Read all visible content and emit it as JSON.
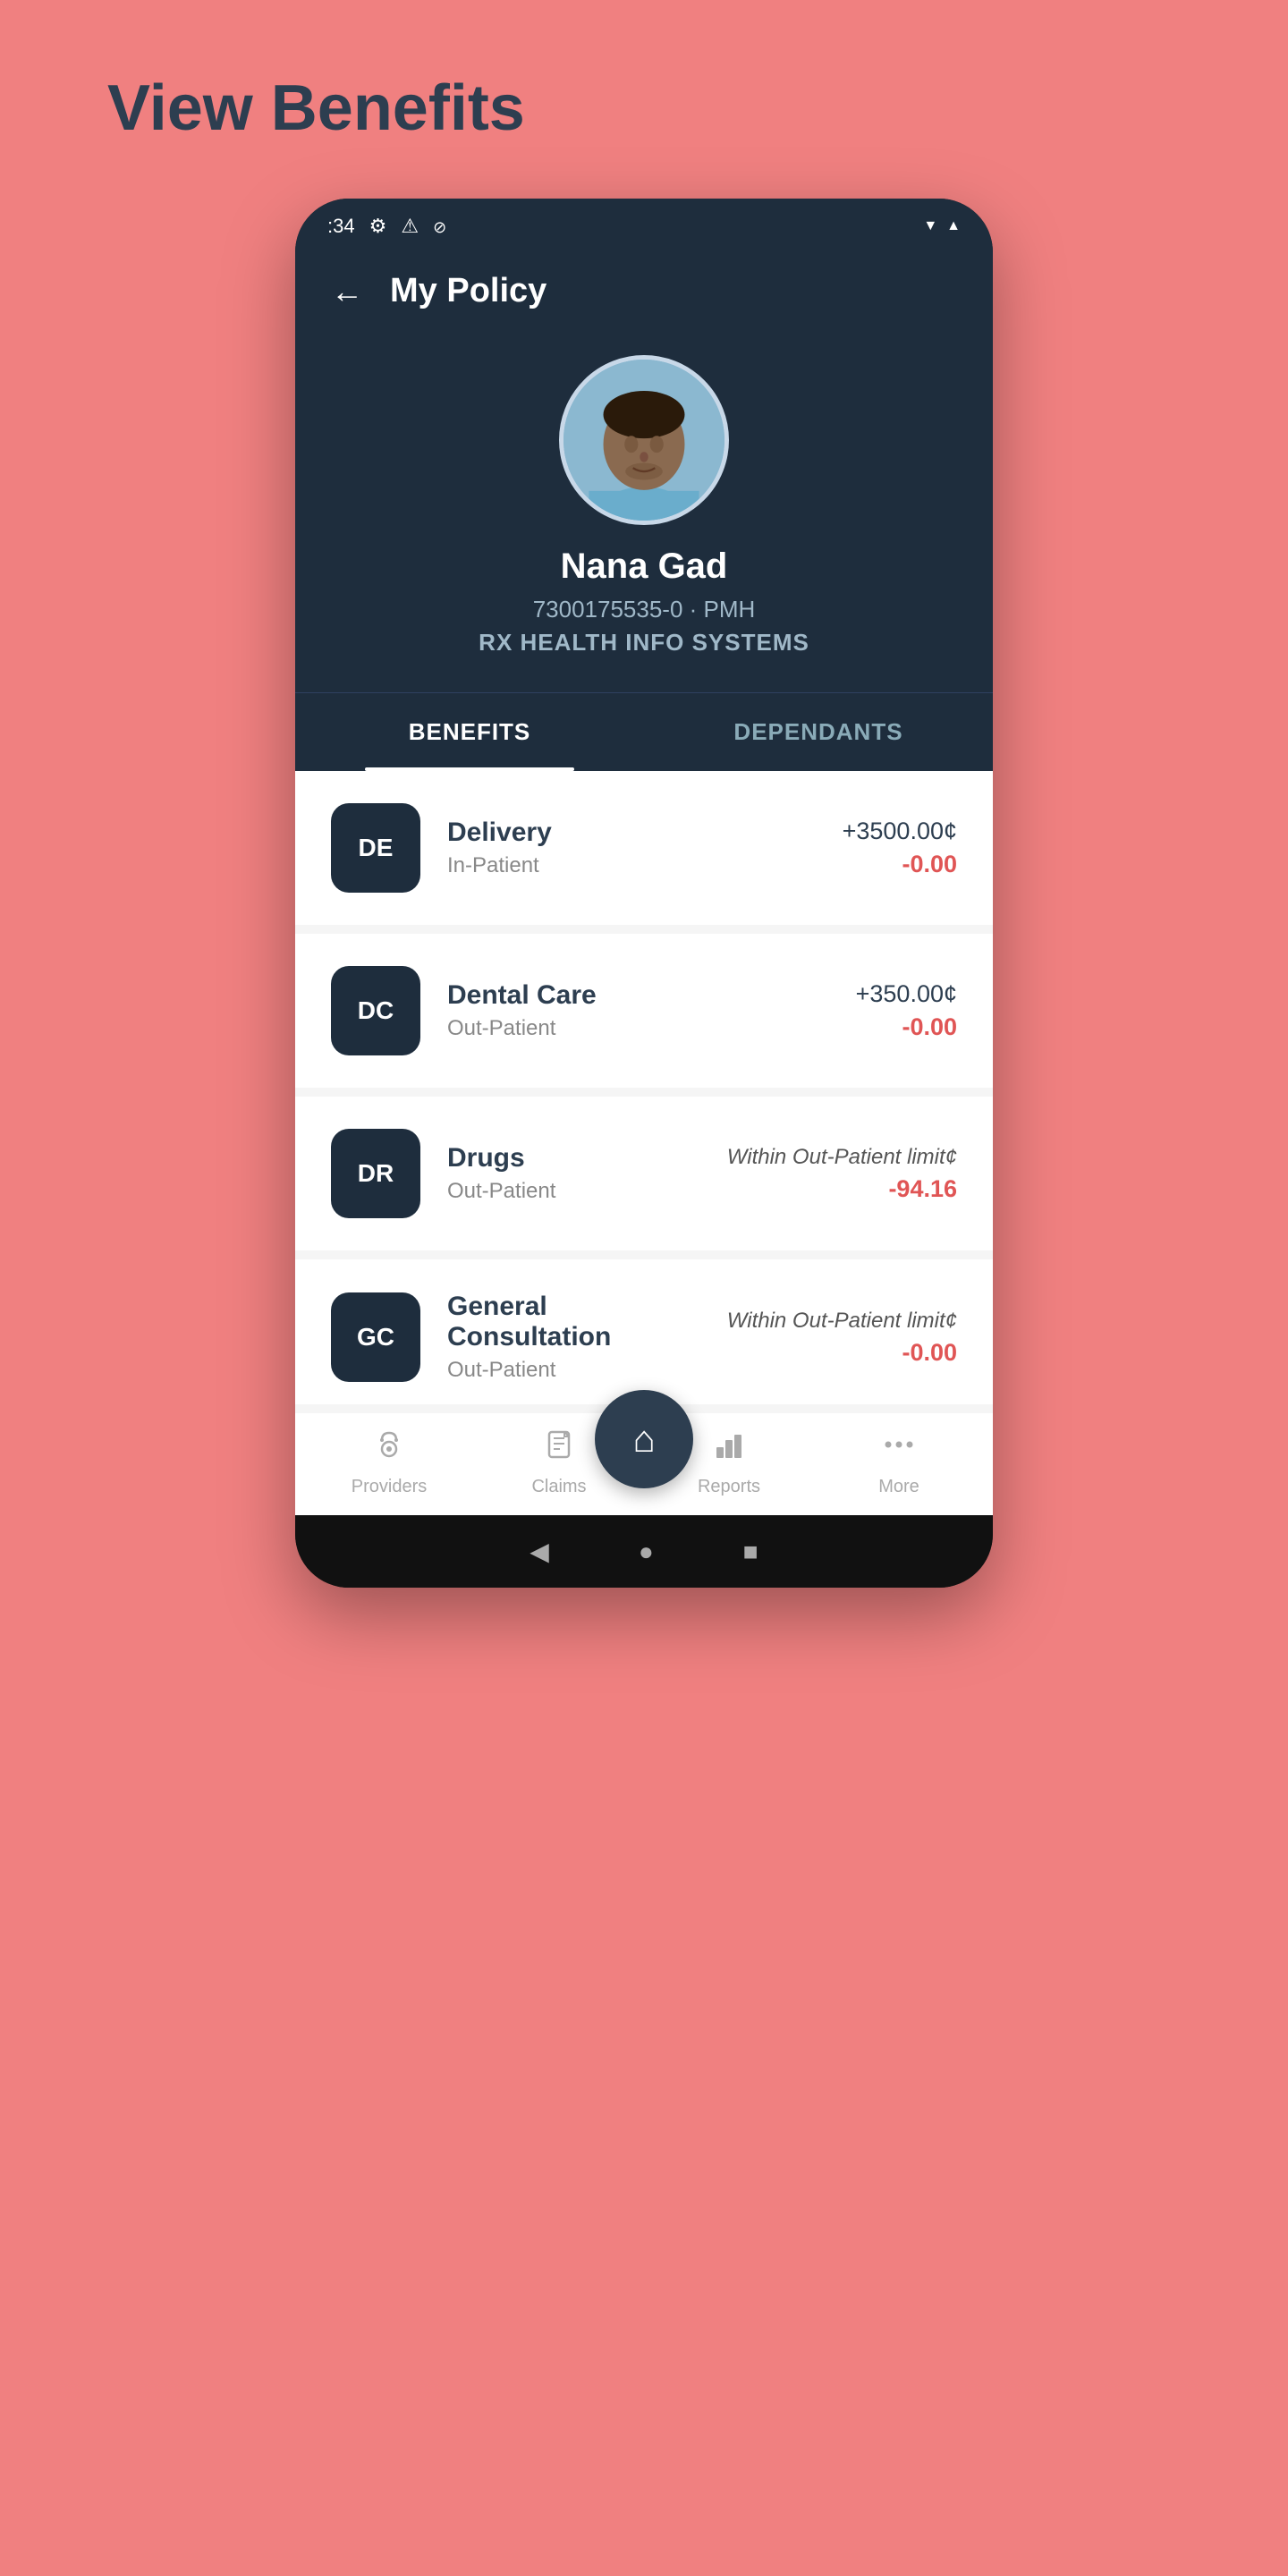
{
  "page": {
    "title": "View Benefits",
    "background": "#F08080"
  },
  "status_bar": {
    "time": ":34",
    "wifi": "▲",
    "signal": "▲"
  },
  "header": {
    "back_label": "←",
    "title": "My Policy"
  },
  "profile": {
    "name": "Nana Gad",
    "policy_id": "7300175535-0 · PMH",
    "company": "RX HEALTH INFO SYSTEMS"
  },
  "tabs": [
    {
      "id": "benefits",
      "label": "BENEFITS",
      "active": true
    },
    {
      "id": "dependants",
      "label": "DEPENDANTS",
      "active": false
    }
  ],
  "benefits": [
    {
      "code": "DE",
      "name": "Delivery",
      "type": "In-Patient",
      "limit": "+3500.00¢",
      "used": "-0.00",
      "limit_is_text": false
    },
    {
      "code": "DC",
      "name": "Dental Care",
      "type": "Out-Patient",
      "limit": "+350.00¢",
      "used": "-0.00",
      "limit_is_text": false
    },
    {
      "code": "DR",
      "name": "Drugs",
      "type": "Out-Patient",
      "limit": "Within Out-Patient limit¢",
      "used": "-94.16",
      "limit_is_text": true
    },
    {
      "code": "GC",
      "name": "General Consultation",
      "type": "Out-Patient",
      "limit": "Within Out-Patient limit¢",
      "used": "-0.00",
      "limit_is_text": true,
      "partial": true
    }
  ],
  "bottom_nav": {
    "home_icon": "🏠",
    "items": [
      {
        "id": "providers",
        "icon": "providers",
        "label": "Providers"
      },
      {
        "id": "claims",
        "icon": "claims",
        "label": "Claims"
      },
      {
        "id": "reports",
        "icon": "reports",
        "label": "Reports"
      },
      {
        "id": "more",
        "icon": "more",
        "label": "More"
      }
    ]
  },
  "android_nav": {
    "back": "◀",
    "home": "●",
    "recent": "■"
  }
}
